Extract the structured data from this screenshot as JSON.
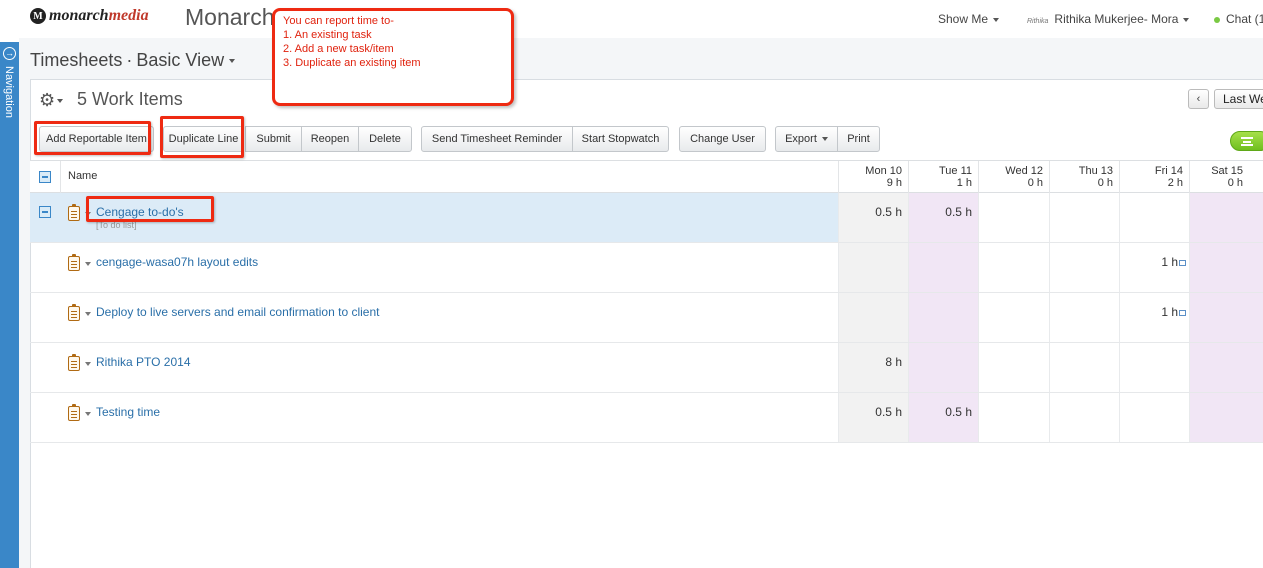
{
  "header": {
    "logo_prefix": "monarch",
    "logo_suffix": "media",
    "app_title": "Monarch",
    "show_me": "Show Me",
    "user_name": "Rithika Mukerjee- Mora",
    "user_sig": "Rithika",
    "chat": "Chat (1"
  },
  "nav": {
    "label": "Navigation"
  },
  "breadcrumb": {
    "section": "Timesheets",
    "separator": "·",
    "view": "Basic View"
  },
  "list": {
    "count_label": "5 Work Items"
  },
  "pager": {
    "prev": "‹",
    "period": "Last We"
  },
  "toolbar": {
    "add_reportable": "Add Reportable Item",
    "duplicate_line": "Duplicate Line",
    "submit": "Submit",
    "reopen": "Reopen",
    "delete": "Delete",
    "send_reminder": "Send Timesheet Reminder",
    "start_stopwatch": "Start Stopwatch",
    "change_user": "Change User",
    "export": "Export",
    "print": "Print"
  },
  "grid": {
    "name_header": "Name",
    "days": [
      {
        "day": "Mon 10",
        "total": "9 h"
      },
      {
        "day": "Tue 11",
        "total": "1 h"
      },
      {
        "day": "Wed 12",
        "total": "0 h"
      },
      {
        "day": "Thu 13",
        "total": "0 h"
      },
      {
        "day": "Fri 14",
        "total": "2 h"
      },
      {
        "day": "Sat 15",
        "total": "0 h"
      }
    ],
    "rows": [
      {
        "name": "Cengage to-do's",
        "sub": "[To do list]",
        "mon": "0.5 h",
        "tue": "0.5 h",
        "wed": "",
        "thu": "",
        "fri": "",
        "sat": ""
      },
      {
        "name": "cengage-wasa07h layout edits",
        "sub": "",
        "mon": "",
        "tue": "",
        "wed": "",
        "thu": "",
        "fri": "1 h",
        "sat": ""
      },
      {
        "name": "Deploy to live servers and email confirmation to client",
        "sub": "",
        "mon": "",
        "tue": "",
        "wed": "",
        "thu": "",
        "fri": "1 h",
        "sat": ""
      },
      {
        "name": "Rithika PTO 2014",
        "sub": "",
        "mon": "8 h",
        "tue": "",
        "wed": "",
        "thu": "",
        "fri": "",
        "sat": ""
      },
      {
        "name": "Testing time",
        "sub": "",
        "mon": "0.5 h",
        "tue": "0.5 h",
        "wed": "",
        "thu": "",
        "fri": "",
        "sat": ""
      }
    ]
  },
  "annotation": {
    "title": "You can report time to-",
    "items": [
      "1. An existing task",
      "2. Add a new task/item",
      "3. Duplicate an existing item"
    ]
  },
  "colors": {
    "accent": "#3a87c8",
    "annotation_red": "#ee2a12",
    "link": "#2a6fa8"
  }
}
